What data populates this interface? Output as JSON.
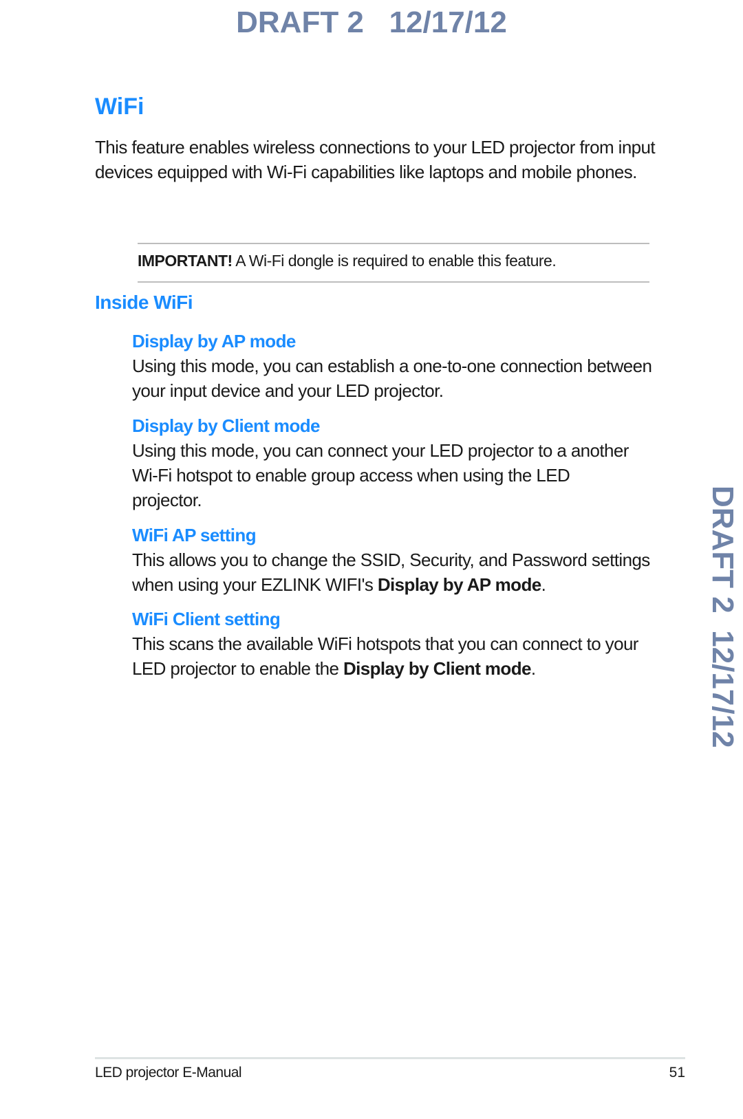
{
  "watermark": {
    "top_text": "DRAFT 2   12/17/12",
    "side_text": "DRAFT 2  12/17/12",
    "color": "#6f83a8"
  },
  "page": {
    "title": "WiFi",
    "intro": "This feature enables wireless connections to your LED projector from input devices equipped with Wi-Fi capabilities like laptops and mobile phones.",
    "important": {
      "label": "IMPORTANT!",
      "text": " A Wi-Fi dongle is required to enable this feature."
    },
    "subtitle": "Inside WiFi",
    "sections": [
      {
        "heading": "Display by AP mode",
        "text": "Using this mode, you can establish a one-to-one connection between your input device and your LED projector."
      },
      {
        "heading": "Display by Client mode",
        "text": "Using this mode, you can connect your LED projector to a another Wi-Fi hotspot to enable group access when using the LED projector."
      },
      {
        "heading": "WiFi AP setting",
        "text": "This allows you to change the SSID, Security, and Password settings when using your EZLINK WIFI's ",
        "bold": "Display by AP mode",
        "end": "."
      },
      {
        "heading": "WiFi Client setting",
        "text": "This scans the available WiFi hotspots that you can connect to your LED projector to enable the ",
        "bold": "Display by Client mode",
        "end": "."
      }
    ],
    "accent_color": "#1a8cff"
  },
  "footer": {
    "manual_name": "LED projector E-Manual",
    "page_number": "51"
  }
}
